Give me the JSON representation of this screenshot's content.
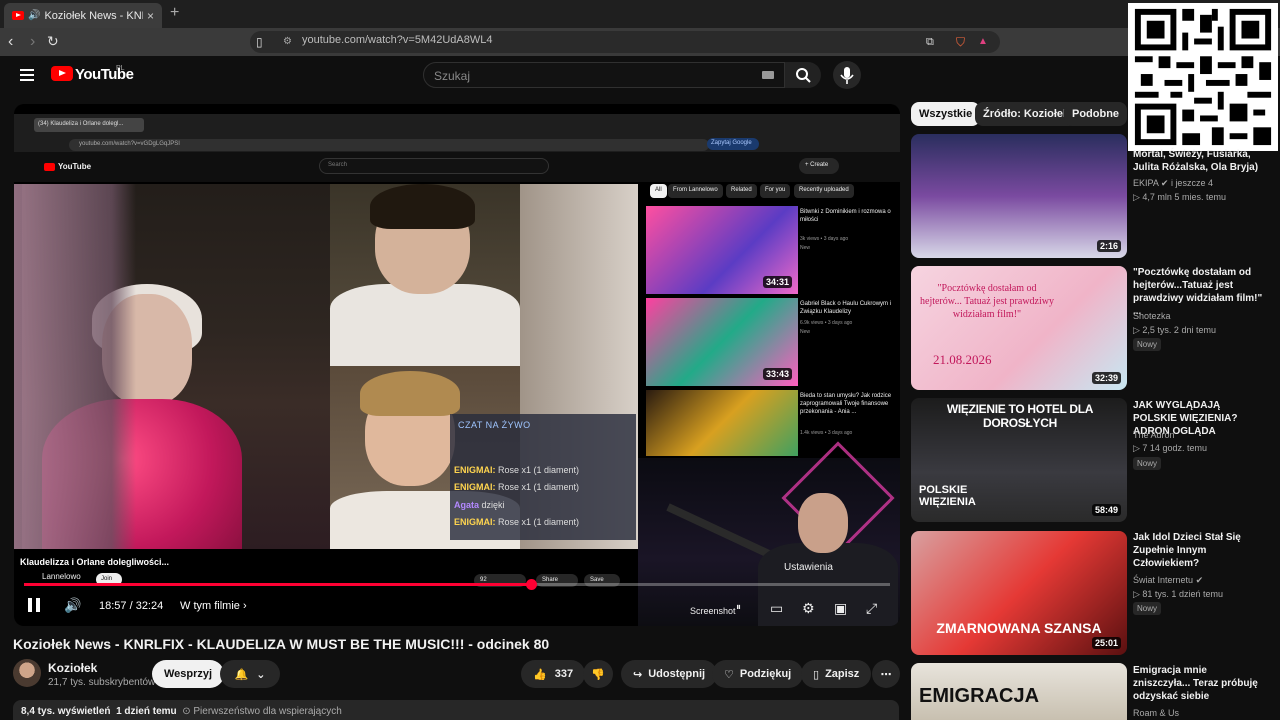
{
  "browser": {
    "tab_title": "Koziołek News - KNRLFIX - KL",
    "url": "youtube.com/watch?v=5M42UdA8WL4"
  },
  "header": {
    "logo_text": "YouTube",
    "region": "PL",
    "search_placeholder": "Szukaj"
  },
  "video": {
    "inner": {
      "tab_title": "(34) Klaudeliza i Orlane dolegl...",
      "url": "youtube.com/watch?v=vGDgLGqJPSI",
      "zap_label": "Zapytaj Google",
      "search_placeholder": "Search",
      "create_label": "+ Create",
      "title": "Klaudelizza i Orlane dolegliwości...",
      "channel": "Lannelowo",
      "join": "Join",
      "likes": "92",
      "share": "Share",
      "save": "Save",
      "chips": [
        "All",
        "From Lannelowo",
        "Related",
        "For you",
        "Recently uploaded"
      ],
      "recs": [
        {
          "title": "Bitwnki z Dominikiem i rozmowa o miłości",
          "meta": "3k views • 3 days ago",
          "badge": "New",
          "duration": "34:31"
        },
        {
          "title": "Gabriel Black o Haulu Cukrowym i Związku Klaudelizy",
          "meta": "6.9k views • 3 days ago",
          "badge": "New",
          "duration": "33:43"
        },
        {
          "title": "Bieda to stan umysłu? Jak rodzice zaprogramowali Twoje finansowe przekonania - Ania ...",
          "meta": "1.4k views • 3 days ago",
          "badge": "",
          "duration": ""
        }
      ]
    },
    "chat": {
      "header": "CZAT NA ŻYWO",
      "lines": [
        {
          "name": "ENIGMAI:",
          "text": "Rose x1 (1 diament)"
        },
        {
          "name": "ENIGMAI:",
          "text": "Rose x1 (1 diament)"
        },
        {
          "name": "Agata",
          "text": "dzięki"
        },
        {
          "name": "ENIGMAI:",
          "text": "Rose x1 (1 diament)"
        }
      ]
    },
    "tooltip": "Ustawienia",
    "screenshot_label": "Screenshot",
    "time": "18:57 / 32:24",
    "progress": 0.585,
    "chapter": "W tym filmie"
  },
  "info": {
    "title": "Koziołek News - KNRLFIX - KLAUDELIZA W MUST BE THE MUSIC!!! - odcinek 80",
    "channel": "Koziołek",
    "subscribers": "21,7 tys. subskrybentów",
    "support_label": "Wesprzyj",
    "likes": "337",
    "share_label": "Udostępnij",
    "thanks_label": "Podziękuj",
    "save_label": "Zapisz",
    "views": "8,4 tys. wyświetleń",
    "date": "1 dzień temu",
    "priority_tag": "Pierwszeństwo dla wspierających"
  },
  "sidebar": {
    "chips": [
      "Wszystkie",
      "Źródło: Koziołek",
      "Podobne"
    ],
    "items": [
      {
        "title": "Mortal, Świeży, Fusiarka, Julita Różalska, Ola Bryja)",
        "channel": "EKIPA",
        "meta": "4,7 mln  5 mies. temu",
        "extra": "i jeszcze 4",
        "badge": "",
        "duration": "2:16"
      },
      {
        "title": "\"Pocztówkę dostałam od hejterów...Tatuaż jest prawdziwy widziałam film!\" ...",
        "channel": "Shotezka",
        "meta": "2,5 tys.  2 dni temu",
        "extra": "",
        "badge": "Nowy",
        "duration": "32:39"
      },
      {
        "title": "JAK WYGLĄDAJĄ POLSKIE WIĘZIENIA? ADRON OGLĄDA",
        "channel": "The Adron",
        "meta": "7  14 godz. temu",
        "extra": "",
        "badge": "Nowy",
        "duration": "58:49"
      },
      {
        "title": "Jak Idol Dzieci Stał Się Zupełnie Innym Człowiekiem?",
        "channel": "Świat Internetu",
        "meta": "81 tys.  1 dzień temu",
        "extra": "",
        "badge": "Nowy",
        "duration": "25:01"
      },
      {
        "title": "Emigracja mnie zniszczyła... Teraz próbuję odzyskać siebie",
        "channel": "Roam & Us",
        "meta": "",
        "extra": "",
        "badge": "",
        "duration": ""
      }
    ],
    "thumb_texts": [
      "",
      "\"Pocztówkę dostałam od hejterów... Tatuaż jest prawdziwy widziałam film!\"",
      "WIĘZIENIE TO HOTEL DLA DOROSŁYCH",
      "ZMARNOWANA SZANSA",
      "EMIGRACJA"
    ],
    "thumb_sub": [
      "",
      "21.08.2026",
      "POLSKIE WIĘZIENIA",
      "",
      ""
    ]
  }
}
